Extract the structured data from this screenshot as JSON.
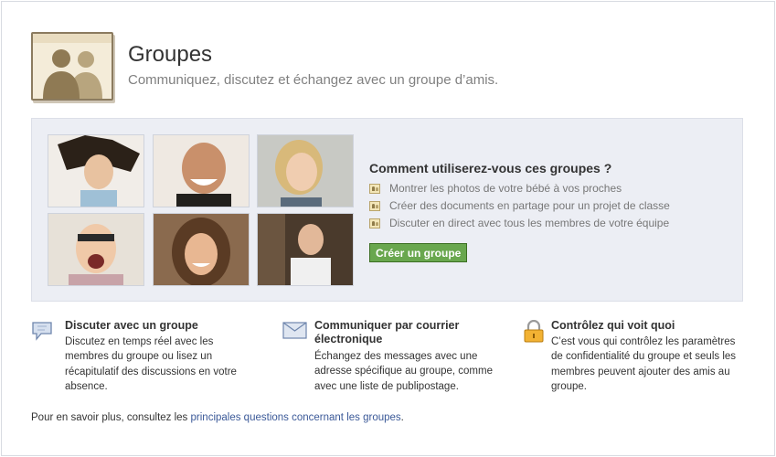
{
  "header": {
    "title": "Groupes",
    "subtitle": "Communiquez, discutez et échangez avec un groupe d’amis."
  },
  "promo": {
    "question": "Comment utiliserez-vous ces groupes ?",
    "bullets": [
      "Montrer les photos de votre bébé à vos proches",
      "Créer des documents en partage pour un projet de classe",
      "Discuter en direct avec tous les membres de votre équipe"
    ],
    "create_button": "Créer un groupe"
  },
  "features": [
    {
      "icon": "chat-bubble-icon",
      "title": "Discuter avec un groupe",
      "desc_lines": [
        "Discutez en temps réel avec les",
        "membres du groupe ou lisez un",
        "récapitulatif des discussions en votre",
        "absence."
      ]
    },
    {
      "icon": "envelope-icon",
      "title_lines": [
        "Communiquer par courrier",
        "électronique"
      ],
      "desc_lines": [
        "Échangez des messages avec une",
        "adresse spécifique au groupe, comme",
        "avec une liste de publipostage."
      ]
    },
    {
      "icon": "padlock-icon",
      "title": "Contrôlez qui voit quoi",
      "desc_lines": [
        "C’est vous qui contrôlez les paramètres",
        "de confidentialité du groupe et seuls les",
        "membres peuvent ajouter des amis au",
        "groupe."
      ]
    }
  ],
  "footer": {
    "prefix": "Pour en savoir plus, consultez les ",
    "link": "principales questions concernant les groupes",
    "suffix": "."
  }
}
